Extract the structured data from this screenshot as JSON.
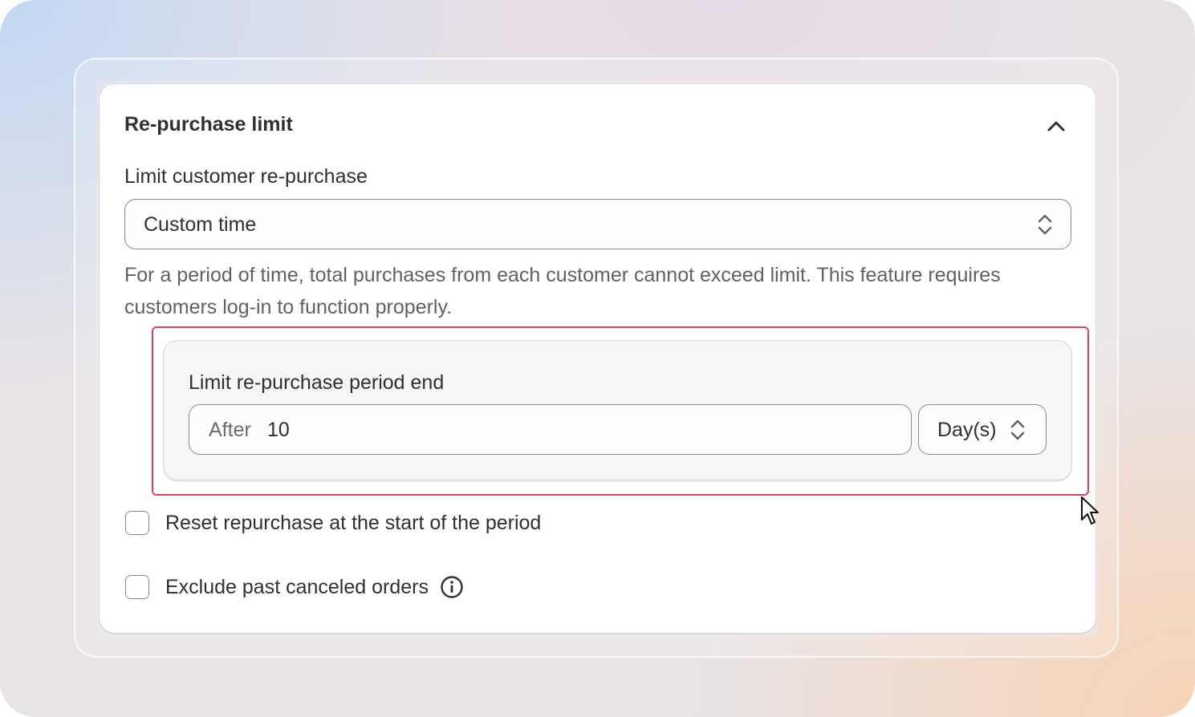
{
  "card": {
    "title": "Re-purchase limit",
    "collapse_icon": "chevron-up-icon"
  },
  "limit_field": {
    "label": "Limit customer re-purchase",
    "selected": "Custom time",
    "help_text": "For a period of time, total purchases from each customer cannot exceed limit. This feature requires customers log-in to function properly."
  },
  "period_end": {
    "label": "Limit re-purchase period end",
    "prefix": "After",
    "value": "10",
    "unit": "Day(s)"
  },
  "options": {
    "reset_label": "Reset repurchase at the start of the period",
    "reset_checked": false,
    "exclude_label": "Exclude past canceled orders",
    "exclude_checked": false
  },
  "colors": {
    "highlight": "#e0415b",
    "text": "#303030",
    "muted": "#616161"
  }
}
